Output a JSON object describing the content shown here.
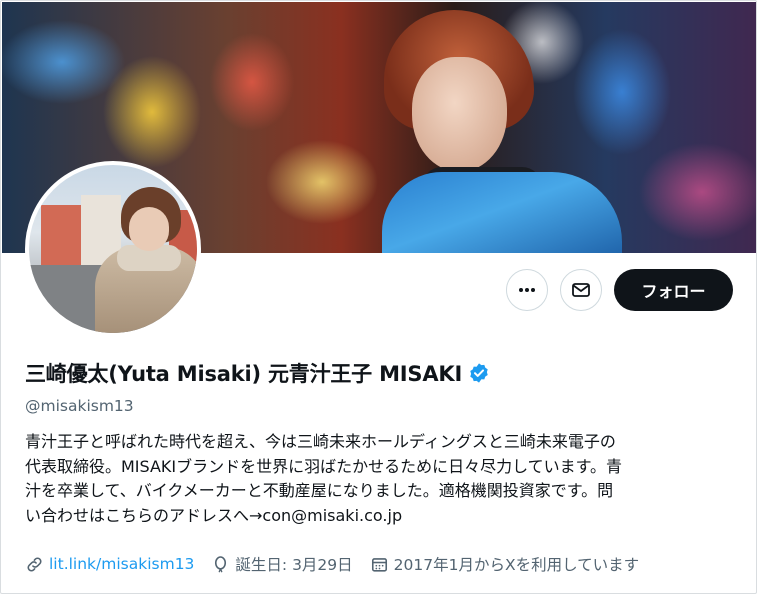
{
  "profile": {
    "display_name": "三崎優太(Yuta Misaki) 元青汁王子 MISAKI",
    "handle": "@misakism13",
    "verified": true,
    "bio_lines": [
      "青汁王子と呼ばれた時代を超え、今は三崎未来ホールディングスと三崎未来電子の",
      "代表取締役。MISAKIブランドを世界に羽ばたかせるために日々尽力しています。青",
      "汁を卒業して、バイクメーカーと不動産屋になりました。適格機関投資家です。問",
      "い合わせはこちらのアドレスへ→con@misaki.co.jp"
    ],
    "link": "lit.link/misakism13",
    "birthday": "誕生日: 3月29日",
    "joined": "2017年1月からXを利用しています"
  },
  "actions": {
    "more_icon": "more-horizontal-icon",
    "message_icon": "mail-icon",
    "follow_label": "フォロー"
  },
  "colors": {
    "accent": "#1d9bf0",
    "text_primary": "#0f1419",
    "text_secondary": "#536471",
    "follow_bg": "#0f1419"
  }
}
